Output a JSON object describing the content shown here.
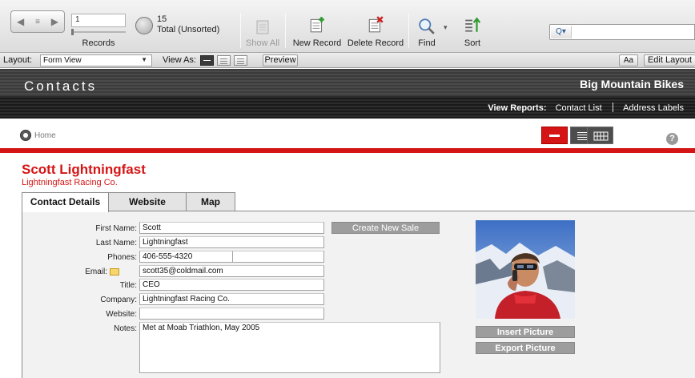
{
  "toolbar": {
    "record_current": "1",
    "records_label": "Records",
    "total_count": "15",
    "total_label": "Total (Unsorted)",
    "show_all_label": "Show All",
    "new_record_label": "New Record",
    "delete_record_label": "Delete Record",
    "find_label": "Find",
    "sort_label": "Sort"
  },
  "layout_bar": {
    "layout_label": "Layout:",
    "layout_value": "Form View",
    "view_as_label": "View As:",
    "preview_label": "Preview",
    "font_label": "Aa",
    "edit_layout_label": "Edit Layout"
  },
  "header": {
    "title": "Contacts",
    "company": "Big Mountain Bikes",
    "view_reports_label": "View Reports:",
    "report_links": [
      "Contact List",
      "Address Labels"
    ]
  },
  "nav": {
    "home_label": "Home",
    "help_symbol": "?"
  },
  "record": {
    "name": "Scott Lightningfast",
    "company": "Lightningfast Racing Co."
  },
  "tabs": [
    "Contact Details",
    "Website",
    "Map"
  ],
  "form": {
    "first_name_label": "First Name:",
    "first_name": "Scott",
    "last_name_label": "Last Name:",
    "last_name": "Lightningfast",
    "phones_label": "Phones:",
    "phone_1": "406-555-4320",
    "phone_2": "",
    "email_label": "Email:",
    "email": "scott35@coldmail.com",
    "title_label": "Title:",
    "title": "CEO",
    "company_label": "Company:",
    "company": "Lightningfast Racing Co.",
    "website_label": "Website:",
    "website": "",
    "notes_label": "Notes:",
    "notes": "Met at Moab Triathlon, May 2005"
  },
  "buttons": {
    "create_new_sale": "Create New Sale",
    "insert_picture": "Insert Picture",
    "export_picture": "Export Picture"
  },
  "colors": {
    "accent_red": "#d51515",
    "header_dark": "#2c2c2c",
    "panel_bg": "#f2f2f2"
  }
}
